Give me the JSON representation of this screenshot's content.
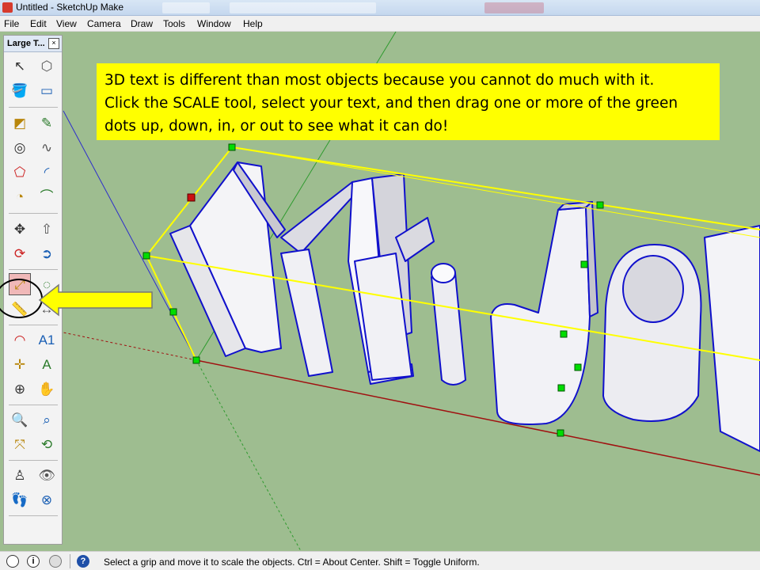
{
  "window": {
    "title": "Untitled - SketchUp Make"
  },
  "menu": [
    "File",
    "Edit",
    "View",
    "Camera",
    "Draw",
    "Tools",
    "Window",
    "Help"
  ],
  "palette": {
    "title": "Large T...",
    "close_glyph": "×",
    "tools": [
      {
        "name": "select-tool-icon",
        "glyph": "↖"
      },
      {
        "name": "make-component-tool-icon",
        "glyph": "⬡"
      },
      {
        "name": "paint-bucket-tool-icon",
        "glyph": "🪣"
      },
      {
        "name": "eraser-tool-icon",
        "glyph": "▭"
      },
      {
        "name": "rectangle-tool-icon",
        "glyph": "◩"
      },
      {
        "name": "line-tool-icon",
        "glyph": "✎"
      },
      {
        "name": "circle-tool-icon",
        "glyph": "◎"
      },
      {
        "name": "freehand-tool-icon",
        "glyph": "∿"
      },
      {
        "name": "polygon-tool-icon",
        "glyph": "⬠"
      },
      {
        "name": "arc-tool-icon",
        "glyph": "◜"
      },
      {
        "name": "pie-tool-icon",
        "glyph": "◔"
      },
      {
        "name": "two-point-arc-tool-icon",
        "glyph": "⌒"
      },
      {
        "name": "move-tool-icon",
        "glyph": "✥"
      },
      {
        "name": "push-pull-tool-icon",
        "glyph": "⇧"
      },
      {
        "name": "rotate-tool-icon",
        "glyph": "⟳"
      },
      {
        "name": "follow-me-tool-icon",
        "glyph": "➲"
      },
      {
        "name": "scale-tool-icon",
        "glyph": "⤢"
      },
      {
        "name": "offset-tool-icon",
        "glyph": "◌"
      },
      {
        "name": "tape-measure-tool-icon",
        "glyph": "📏"
      },
      {
        "name": "dimension-tool-icon",
        "glyph": "↔"
      },
      {
        "name": "protractor-tool-icon",
        "glyph": "◠"
      },
      {
        "name": "text-tool-icon",
        "glyph": "A1"
      },
      {
        "name": "axes-tool-icon",
        "glyph": "✛"
      },
      {
        "name": "3d-text-tool-icon",
        "glyph": "A"
      },
      {
        "name": "orbit-tool-icon",
        "glyph": "⊕"
      },
      {
        "name": "pan-tool-icon",
        "glyph": "✋"
      },
      {
        "name": "zoom-tool-icon",
        "glyph": "🔍"
      },
      {
        "name": "zoom-window-tool-icon",
        "glyph": "⌕"
      },
      {
        "name": "zoom-extents-tool-icon",
        "glyph": "⤧"
      },
      {
        "name": "previous-view-tool-icon",
        "glyph": "⟲"
      },
      {
        "name": "position-camera-tool-icon",
        "glyph": "♙"
      },
      {
        "name": "look-around-tool-icon",
        "glyph": "👁"
      },
      {
        "name": "walk-tool-icon",
        "glyph": "👣"
      },
      {
        "name": "section-plane-tool-icon",
        "glyph": "⊗"
      }
    ]
  },
  "callout": {
    "lines": [
      "3D text is different than most objects because you cannot do much with it.",
      "Click the SCALE tool, select your text, and then drag one or more of the green",
      "dots up, down, in, or out to see what it can do!"
    ]
  },
  "model": {
    "text": "Mr. Joh"
  },
  "status": {
    "icons": [
      "info-icon",
      "credits-icon",
      "user-icon",
      "help-icon"
    ],
    "help_glyph": "?",
    "info_glyph": "i",
    "text": "Select a grip and move it to scale the objects. Ctrl = About Center. Shift = Toggle Uniform."
  },
  "colors": {
    "background": "#9ebd90",
    "callout": "#ffff00",
    "selection": "#ffff00",
    "grip": "#00cc00",
    "edge": "#0000cc"
  }
}
